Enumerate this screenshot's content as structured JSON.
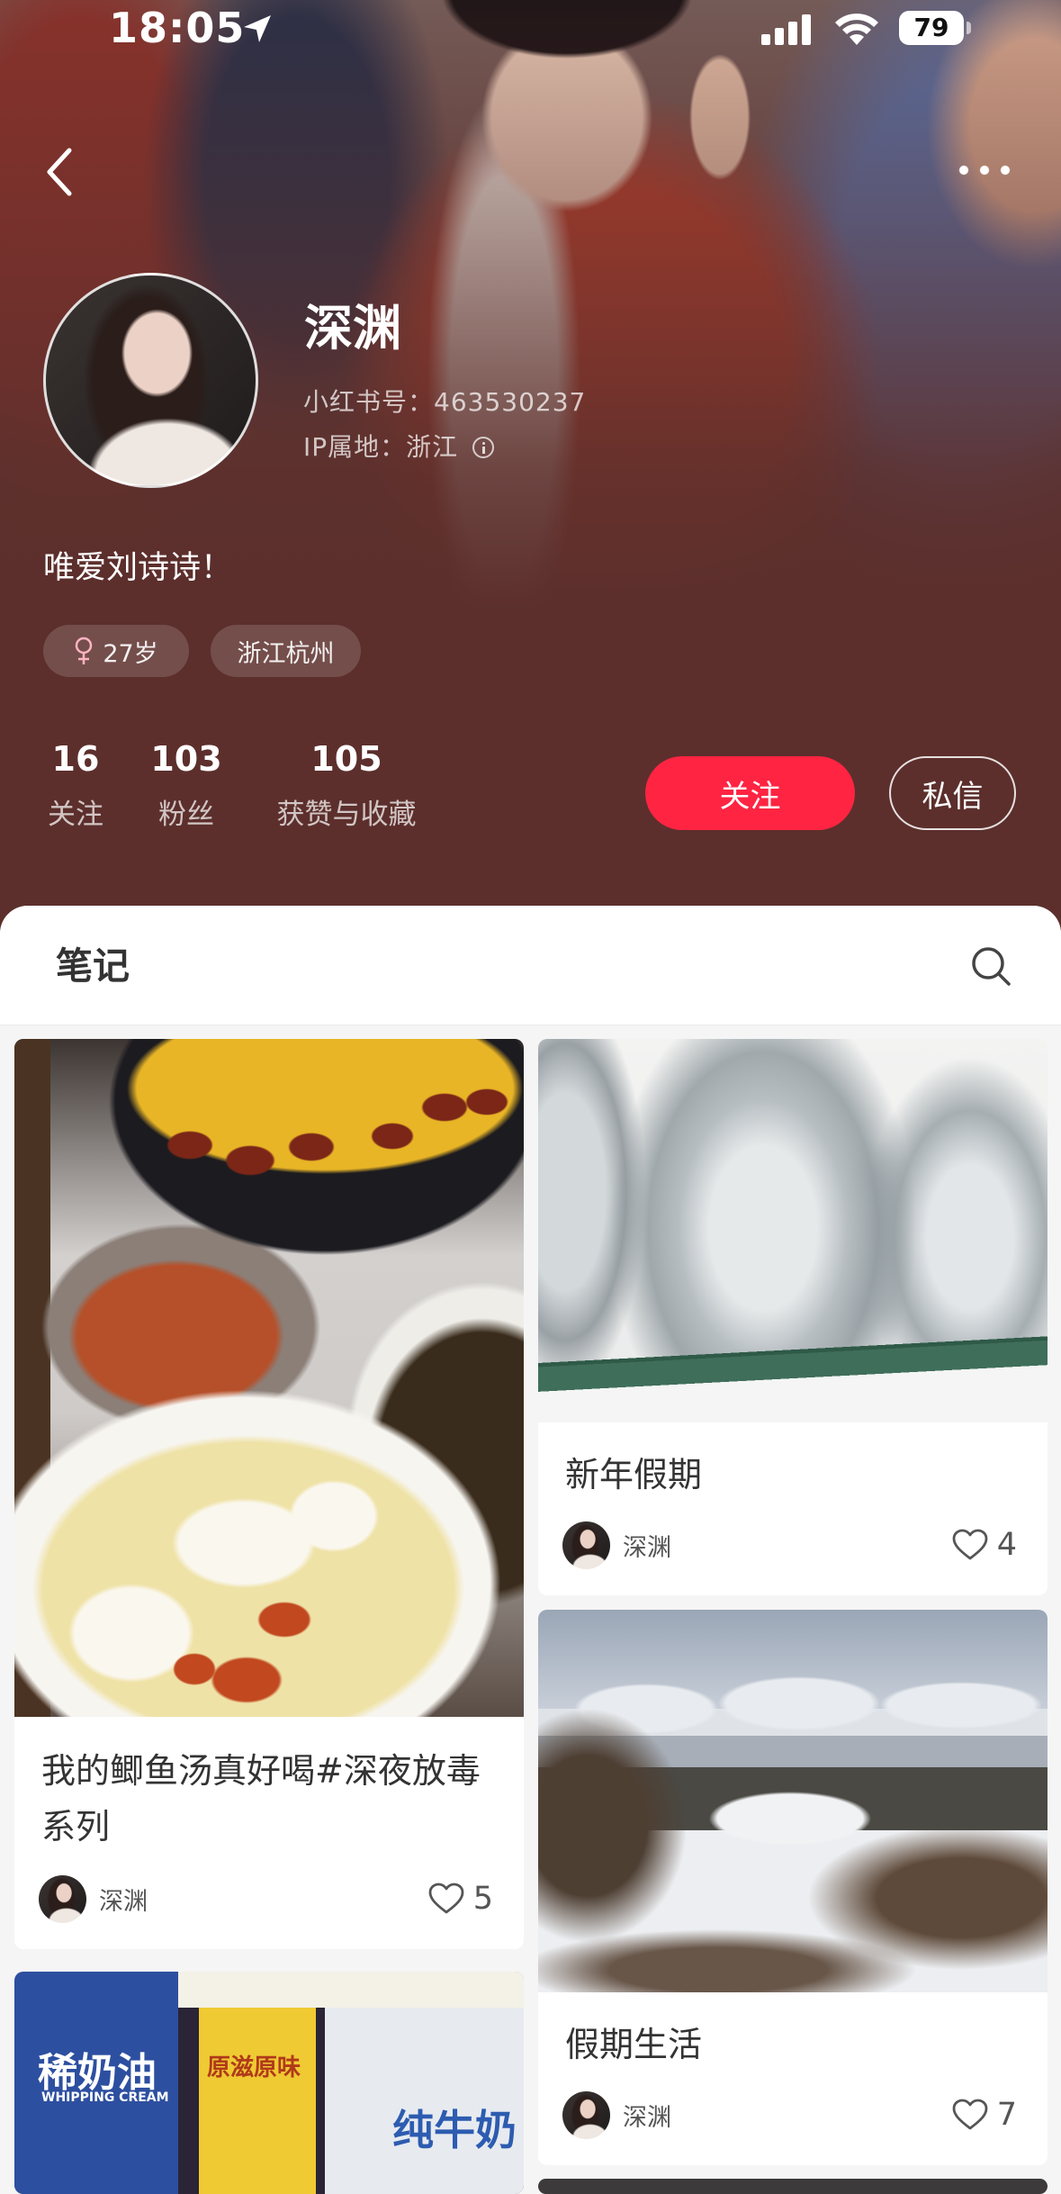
{
  "status_bar": {
    "time": "18:05",
    "battery": "79"
  },
  "profile": {
    "name": "深渊",
    "red_id": "小红书号：463530237",
    "ip_location": "IP属地：浙江",
    "bio": "唯爱刘诗诗！",
    "tags": {
      "age": "27岁",
      "location": "浙江杭州"
    },
    "stats": [
      {
        "value": "16",
        "label": "关注"
      },
      {
        "value": "103",
        "label": "粉丝"
      },
      {
        "value": "105",
        "label": "获赞与收藏"
      }
    ],
    "follow_button": "关注",
    "message_button": "私信"
  },
  "tabs": {
    "notes": "笔记"
  },
  "notes": [
    {
      "title": "我的鲫鱼汤真好喝#深夜放毒系列",
      "author": "深渊",
      "likes": "5"
    },
    {
      "title": "新年假期",
      "author": "深渊",
      "likes": "4"
    },
    {
      "title": "假期生活",
      "author": "深渊",
      "likes": "7"
    }
  ],
  "photo_text": {
    "cream": "稀奶油",
    "cream_en": "WHIPPING CREAM",
    "condensed_milk": "原滋原味",
    "milk": "纯牛奶"
  },
  "icons": {
    "back": "chevron-left-icon",
    "more": "more-dots-icon",
    "search": "search-icon",
    "like": "heart-icon",
    "gender": "female-icon",
    "info": "info-icon"
  },
  "colors": {
    "accent": "#FF2442",
    "header_bg": "#5C2F2C",
    "page_bg": "#F5F5F5"
  }
}
